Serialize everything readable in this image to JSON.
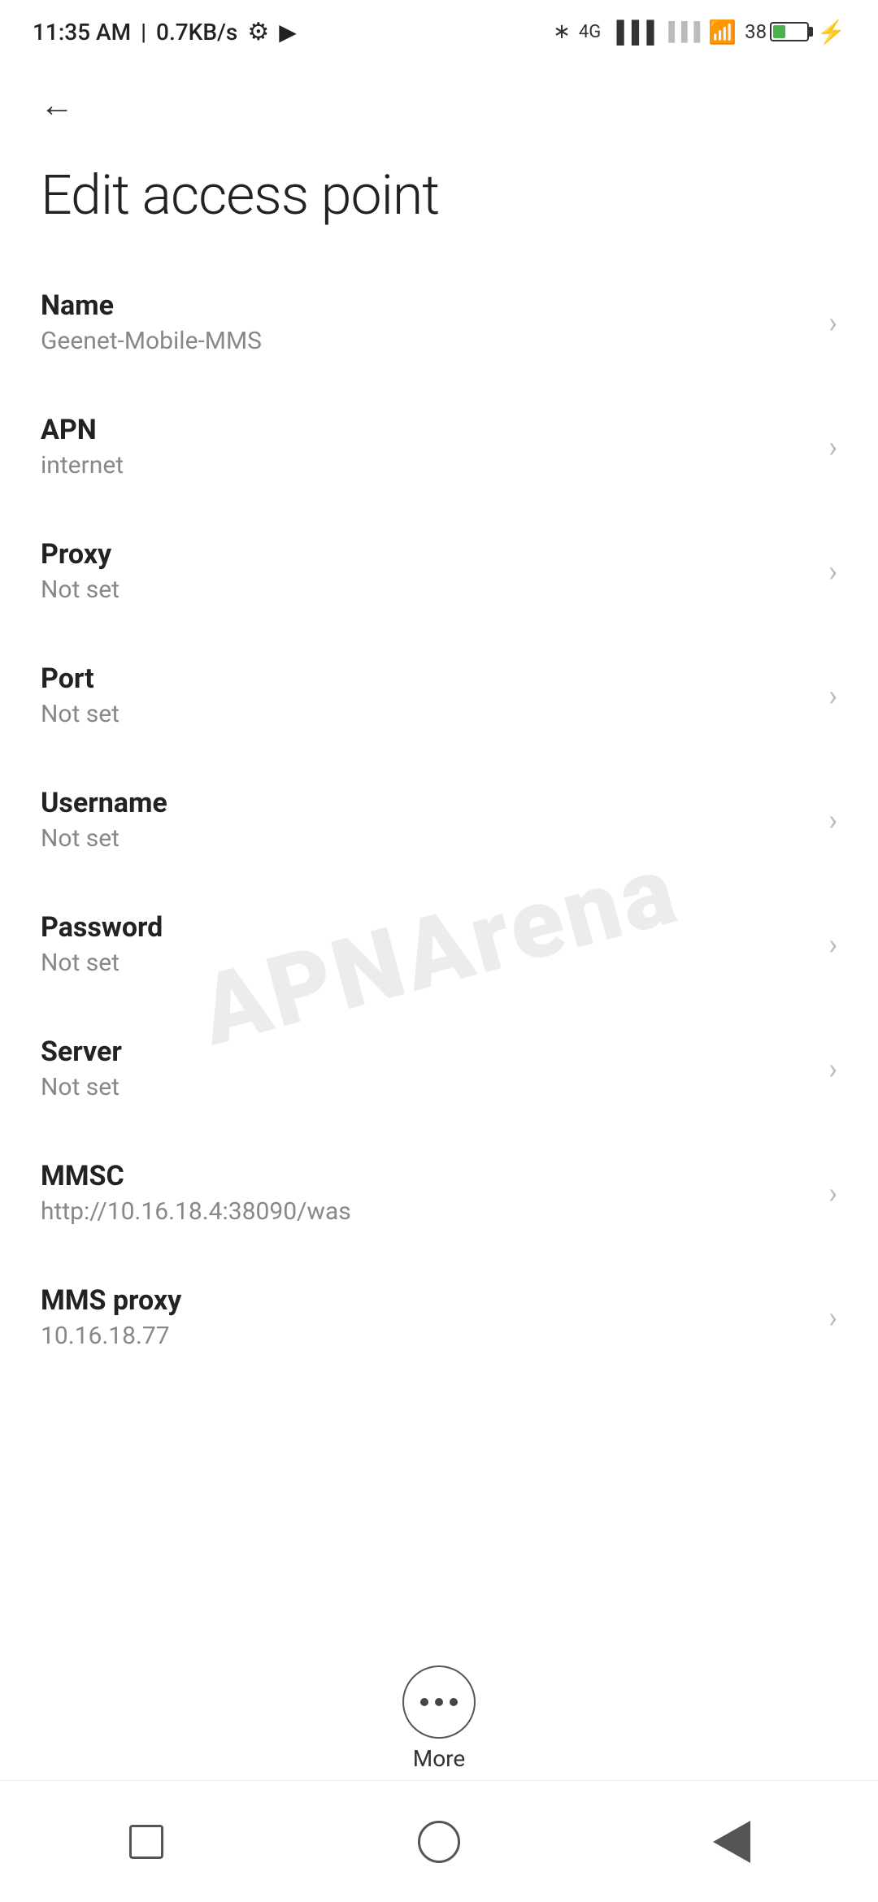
{
  "statusBar": {
    "time": "11:35 AM",
    "speed": "0.7KB/s"
  },
  "header": {
    "backLabel": "←",
    "title": "Edit access point"
  },
  "settings": [
    {
      "id": "name",
      "label": "Name",
      "value": "Geenet-Mobile-MMS"
    },
    {
      "id": "apn",
      "label": "APN",
      "value": "internet"
    },
    {
      "id": "proxy",
      "label": "Proxy",
      "value": "Not set"
    },
    {
      "id": "port",
      "label": "Port",
      "value": "Not set"
    },
    {
      "id": "username",
      "label": "Username",
      "value": "Not set"
    },
    {
      "id": "password",
      "label": "Password",
      "value": "Not set"
    },
    {
      "id": "server",
      "label": "Server",
      "value": "Not set"
    },
    {
      "id": "mmsc",
      "label": "MMSC",
      "value": "http://10.16.18.4:38090/was"
    },
    {
      "id": "mms-proxy",
      "label": "MMS proxy",
      "value": "10.16.18.77"
    }
  ],
  "more": {
    "label": "More"
  },
  "nav": {
    "square": "square-nav",
    "circle": "circle-nav",
    "triangle": "triangle-nav"
  }
}
